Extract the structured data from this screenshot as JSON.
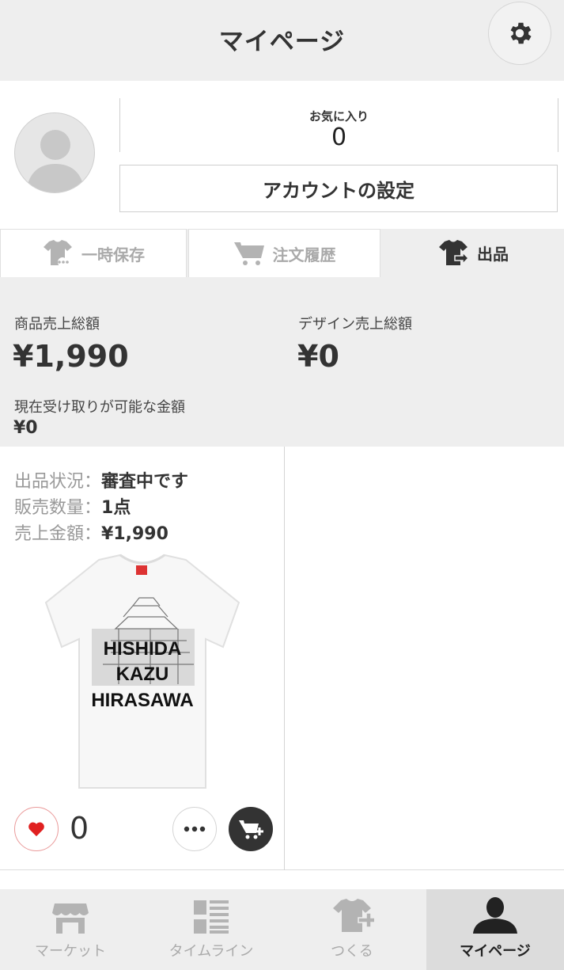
{
  "header": {
    "title": "マイページ"
  },
  "profile": {
    "favorites_label": "お気に入り",
    "favorites_count": "0",
    "account_button": "アカウントの設定"
  },
  "tabs": [
    {
      "label": "一時保存",
      "icon": "tshirt-dots-icon",
      "active": false
    },
    {
      "label": "注文履歴",
      "icon": "cart-icon",
      "active": false
    },
    {
      "label": "出品",
      "icon": "tshirt-export-icon",
      "active": true
    }
  ],
  "sales": {
    "product_total_label": "商品売上総額",
    "product_total_value": "¥1,990",
    "design_total_label": "デザイン売上総額",
    "design_total_value": "¥0",
    "receivable_label": "現在受け取りが可能な金額",
    "receivable_value": "¥0"
  },
  "listing": {
    "status_label": "出品状況：",
    "status_value": "審査中です",
    "quantity_label": "販売数量：",
    "quantity_value": "1点",
    "amount_label": "売上金額：",
    "amount_value": "¥1,990",
    "shirt_lines": [
      "HISHIDA",
      "KAZU",
      "HIRASAWA"
    ],
    "like_count": "0"
  },
  "bottom_nav": [
    {
      "label": "マーケット",
      "icon": "store-icon",
      "active": false
    },
    {
      "label": "タイムライン",
      "icon": "timeline-icon",
      "active": false
    },
    {
      "label": "つくる",
      "icon": "tshirt-plus-icon",
      "active": false
    },
    {
      "label": "マイページ",
      "icon": "person-icon",
      "active": true
    }
  ],
  "colors": {
    "accent_red": "#e02020",
    "dark": "#333333",
    "inactive": "#aaaaaa",
    "panel": "#eeeeee"
  }
}
